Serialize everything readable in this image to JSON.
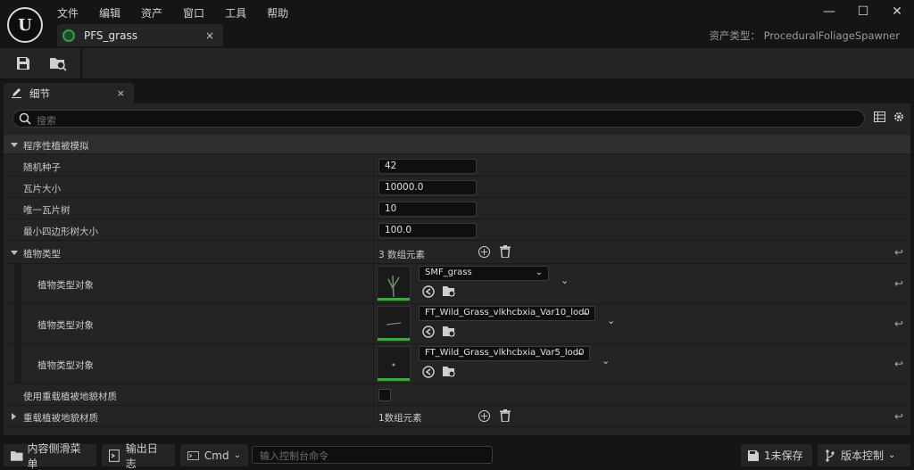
{
  "menu": [
    "文件",
    "编辑",
    "资产",
    "窗口",
    "工具",
    "帮助"
  ],
  "document_tab": {
    "label": "PFS_grass",
    "close": "×"
  },
  "asset_type": "资产类型： ProceduralFoliageSpawner",
  "window_controls": {
    "minimize": "—",
    "maximize": "☐",
    "close": "✕"
  },
  "panel_tab": {
    "label": "细节",
    "close": "×"
  },
  "search": {
    "placeholder": "搜索"
  },
  "category": {
    "label": "程序性植被模拟"
  },
  "properties": [
    {
      "label": "随机种子",
      "value": "42"
    },
    {
      "label": "瓦片大小",
      "value": "10000.0"
    },
    {
      "label": "唯一瓦片树",
      "value": "10"
    },
    {
      "label": "最小四边形树大小",
      "value": "100.0"
    }
  ],
  "foliage_types": {
    "label": "植物类型",
    "count": "3 数组元素",
    "items": [
      {
        "label": "植物类型对象",
        "asset": "SMF_grass"
      },
      {
        "label": "植物类型对象",
        "asset": "FT_Wild_Grass_vlkhcbxia_Var10_lod0"
      },
      {
        "label": "植物类型对象",
        "asset": "FT_Wild_Grass_vlkhcbxia_Var5_lod0"
      }
    ]
  },
  "override_landscape": {
    "label": "使用重载植被地貌材质"
  },
  "override_materials": {
    "label": "重载植被地貌材质",
    "count": "1数组元素"
  },
  "statusbar": {
    "content_drawer": "内容侧滑菜单",
    "output_log": "输出日志",
    "cmd": "Cmd",
    "console_placeholder": "输入控制台命令",
    "unsaved": "1未保存",
    "source_control": "版本控制"
  },
  "colors": {
    "accent_green": "#2db32d",
    "panel_bg": "#242424",
    "window_bg": "#151515"
  }
}
